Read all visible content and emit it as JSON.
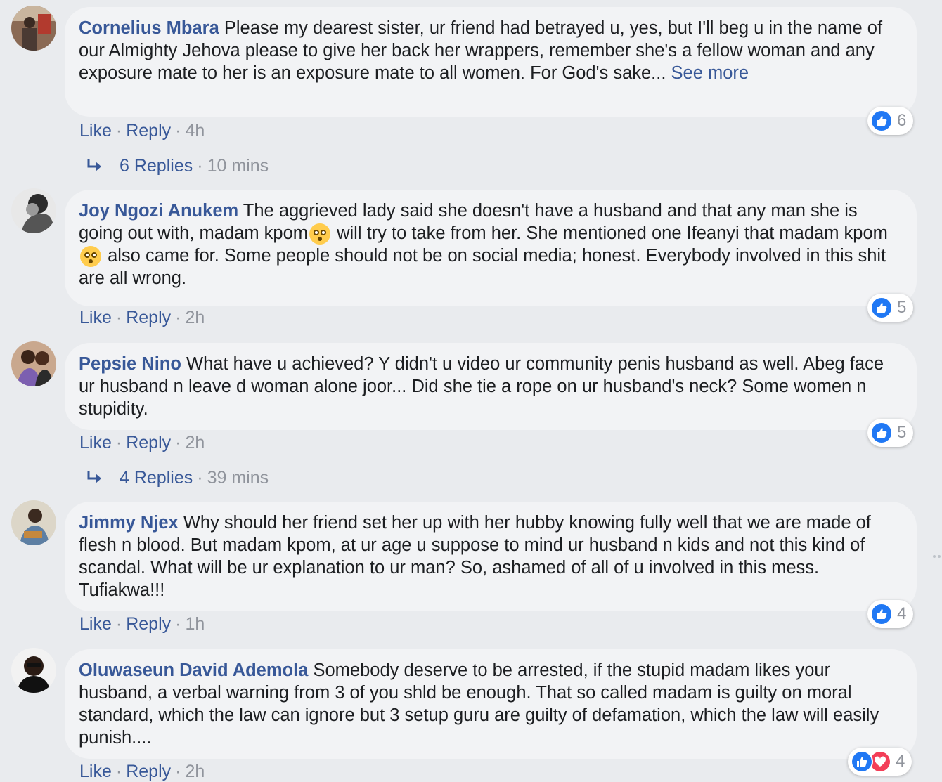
{
  "comments": [
    {
      "author": "Cornelius Mbara",
      "text1": " Please my dearest sister, ur friend had betrayed u, yes, but I'll beg u in the name of our Almighty Jehova please to give her back her wrappers, remember she's a fellow woman and any exposure mate to her is an exposure mate to all women. For God's sake... ",
      "see_more": "See more",
      "like": "Like",
      "reply": "Reply",
      "dot": "·",
      "time": "4h",
      "reactions": "6",
      "replies_label": "6 Replies",
      "replies_time": "10 mins"
    },
    {
      "author": "Joy Ngozi Anukem",
      "text1": " The aggrieved lady said she doesn't have a husband and that any man she is going out with, madam kpom",
      "text2": " will try to take from her. She mentioned one Ifeanyi that madam kpom",
      "text3": " also came for. Some people should not be on social media; honest. Everybody involved in this shit are all wrong.",
      "like": "Like",
      "reply": "Reply",
      "dot": "·",
      "time": "2h",
      "reactions": "5"
    },
    {
      "author": "Pepsie Nino",
      "text1": " What have u achieved? Y didn't u video ur community penis husband as well. Abeg face ur husband n leave d woman alone joor... Did she tie a rope on ur husband's neck? Some women n stupidity.",
      "like": "Like",
      "reply": "Reply",
      "dot": "·",
      "time": "2h",
      "reactions": "5",
      "replies_label": "4 Replies",
      "replies_time": "39 mins"
    },
    {
      "author": "Jimmy Njex",
      "text1": " Why should her friend set her up with her hubby knowing fully well that we are made of flesh n blood. But madam kpom, at ur age u suppose to mind ur husband n kids and not this kind of scandal. What will be ur explanation to ur man? So, ashamed of all of u involved in this mess. Tufiakwa!!!",
      "like": "Like",
      "reply": "Reply",
      "dot": "·",
      "time": "1h",
      "reactions": "4"
    },
    {
      "author": "Oluwaseun David Ademola",
      "text1": " Somebody deserve to be arrested, if the stupid madam likes your husband, a verbal warning from 3 of you shld be enough. That so called madam is guilty on moral standard, which the law can ignore but 3 setup guru are guilty of defamation, which the law will easily punish....",
      "like": "Like",
      "reply": "Reply",
      "dot": "·",
      "time": "2h",
      "reactions": "4"
    }
  ],
  "colors": {
    "link": "#385898",
    "muted": "#90949c",
    "bubble": "#f2f3f5",
    "background": "#e9ebee",
    "like_blue": "#2078f4",
    "love_red": "#f33e58"
  },
  "icons": [
    "avatar",
    "like-icon",
    "love-icon",
    "reply-arrow-icon",
    "flushed-emoji-icon"
  ]
}
